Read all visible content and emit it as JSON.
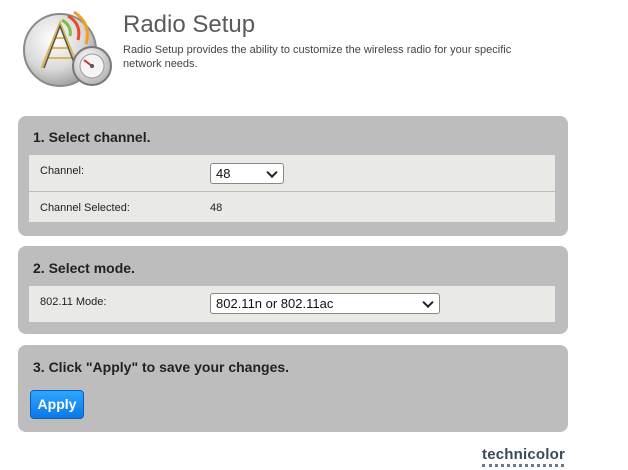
{
  "header": {
    "title": "Radio Setup",
    "description": "Radio Setup provides the ability to customize the wireless radio for your specific network needs."
  },
  "section_channel": {
    "title": "1. Select channel.",
    "channel_label": "Channel:",
    "channel_value": "48",
    "selected_label": "Channel Selected:",
    "selected_value": "48"
  },
  "section_mode": {
    "title": "2. Select mode.",
    "mode_label": "802.11 Mode:",
    "mode_value": "802.11n or 802.11ac"
  },
  "section_apply": {
    "title": "3. Click \"Apply\" to save your changes.",
    "apply_label": "Apply"
  },
  "footer": {
    "brand": "technicolor"
  },
  "colors": {
    "panel": "#bdbdbd",
    "row": "#e9e9e6",
    "accent": "#0a78e8"
  },
  "icons": {
    "logo": "radio-tower-gauge-icon"
  }
}
